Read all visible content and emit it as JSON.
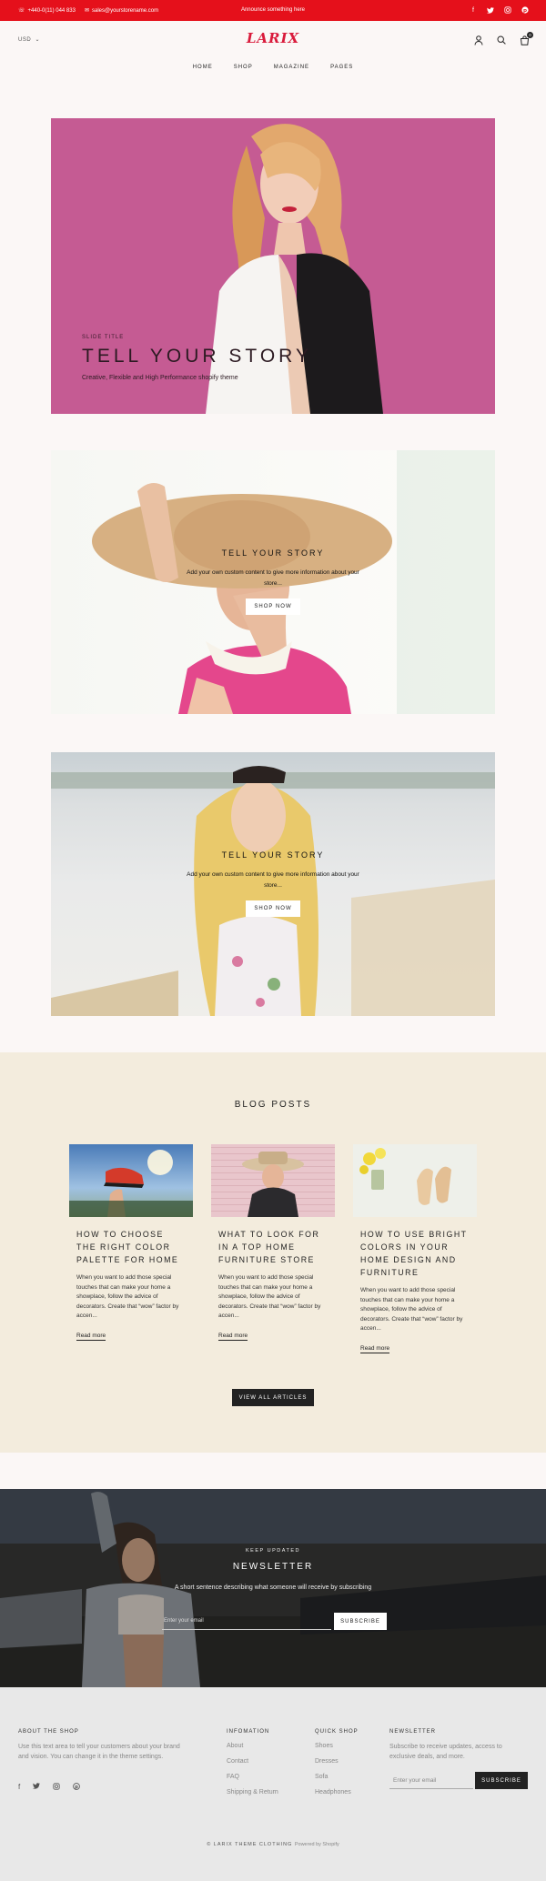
{
  "announcement": {
    "phone": "+440-0(11) 044 833",
    "email": "sales@yourstorename.com",
    "text": "Announce something here",
    "social_icons": [
      "facebook-icon",
      "twitter-icon",
      "instagram-icon",
      "pinterest-icon"
    ]
  },
  "header": {
    "currency": "USD",
    "logo": "LARIX",
    "nav": [
      "HOME",
      "SHOP",
      "MAGAZINE",
      "PAGES"
    ],
    "icons": [
      "account-icon",
      "search-icon",
      "cart-icon"
    ],
    "cart_count": "0"
  },
  "hero": {
    "eyebrow": "SLIDE TITLE",
    "title": "TELL YOUR STORY",
    "subtitle": "Creative, Flexible and High Performance shopify theme"
  },
  "content_blocks": [
    {
      "title": "TELL YOUR STORY",
      "description": "Add your own custom content to give more information about your store...",
      "button": "SHOP NOW"
    },
    {
      "title": "TELL YOUR STORY",
      "description": "Add your own custom content to give more information about your store...",
      "button": "SHOP NOW"
    }
  ],
  "blog": {
    "heading": "BLOG POSTS",
    "posts": [
      {
        "title": "HOW TO CHOOSE THE RIGHT COLOR PALETTE FOR HOME",
        "excerpt": "When you want to add those special touches that can make your home a showplace, follow the advice of decorators. Create that “wow” factor by accen...",
        "link": "Read more"
      },
      {
        "title": "WHAT TO LOOK FOR IN A TOP HOME FURNITURE STORE",
        "excerpt": "When you want to add those special touches that can make your home a showplace, follow the advice of decorators. Create that “wow” factor by accen...",
        "link": "Read more"
      },
      {
        "title": "HOW TO USE BRIGHT COLORS IN YOUR HOME DESIGN AND FURNITURE",
        "excerpt": "When you want to add those special touches that can make your home a showplace, follow the advice of decorators. Create that “wow” factor by accen...",
        "link": "Read more"
      }
    ],
    "view_all": "VIEW ALL ARTICLES"
  },
  "newsletter": {
    "eyebrow": "KEEP UPDATED",
    "title": "NEWSLETTER",
    "description": "A short sentence describing what someone will receive by subscribing",
    "placeholder": "Enter your email",
    "button": "SUBSCRIBE"
  },
  "footer": {
    "about": {
      "heading": "ABOUT THE SHOP",
      "text": "Use this text area to tell your customers about your brand and vision. You can change it in the theme settings."
    },
    "information": {
      "heading": "INFOMATION",
      "links": [
        "About",
        "Contact",
        "FAQ",
        "Shipping & Return"
      ]
    },
    "quick_shop": {
      "heading": "QUICK SHOP",
      "links": [
        "Shoes",
        "Dresses",
        "Sofa",
        "Headphones"
      ]
    },
    "newsletter": {
      "heading": "NEWSLETTER",
      "text": "Subscribe to receive updates, access to exclusive deals, and more.",
      "placeholder": "Enter your email",
      "button": "SUBSCRIBE"
    },
    "social_icons": [
      "facebook-icon",
      "twitter-icon",
      "instagram-icon",
      "pinterest-icon"
    ],
    "copyright": "© LARIX THEME CLOTHING",
    "powered": "Powered by Shopify"
  },
  "colors": {
    "accent": "#e5101b",
    "logo": "#d91a3b",
    "hero_bg": "#c55b93",
    "blog_bg": "#f3ecdd",
    "footer_bg": "#e8e8e8",
    "page_bg": "#fbf7f6"
  }
}
